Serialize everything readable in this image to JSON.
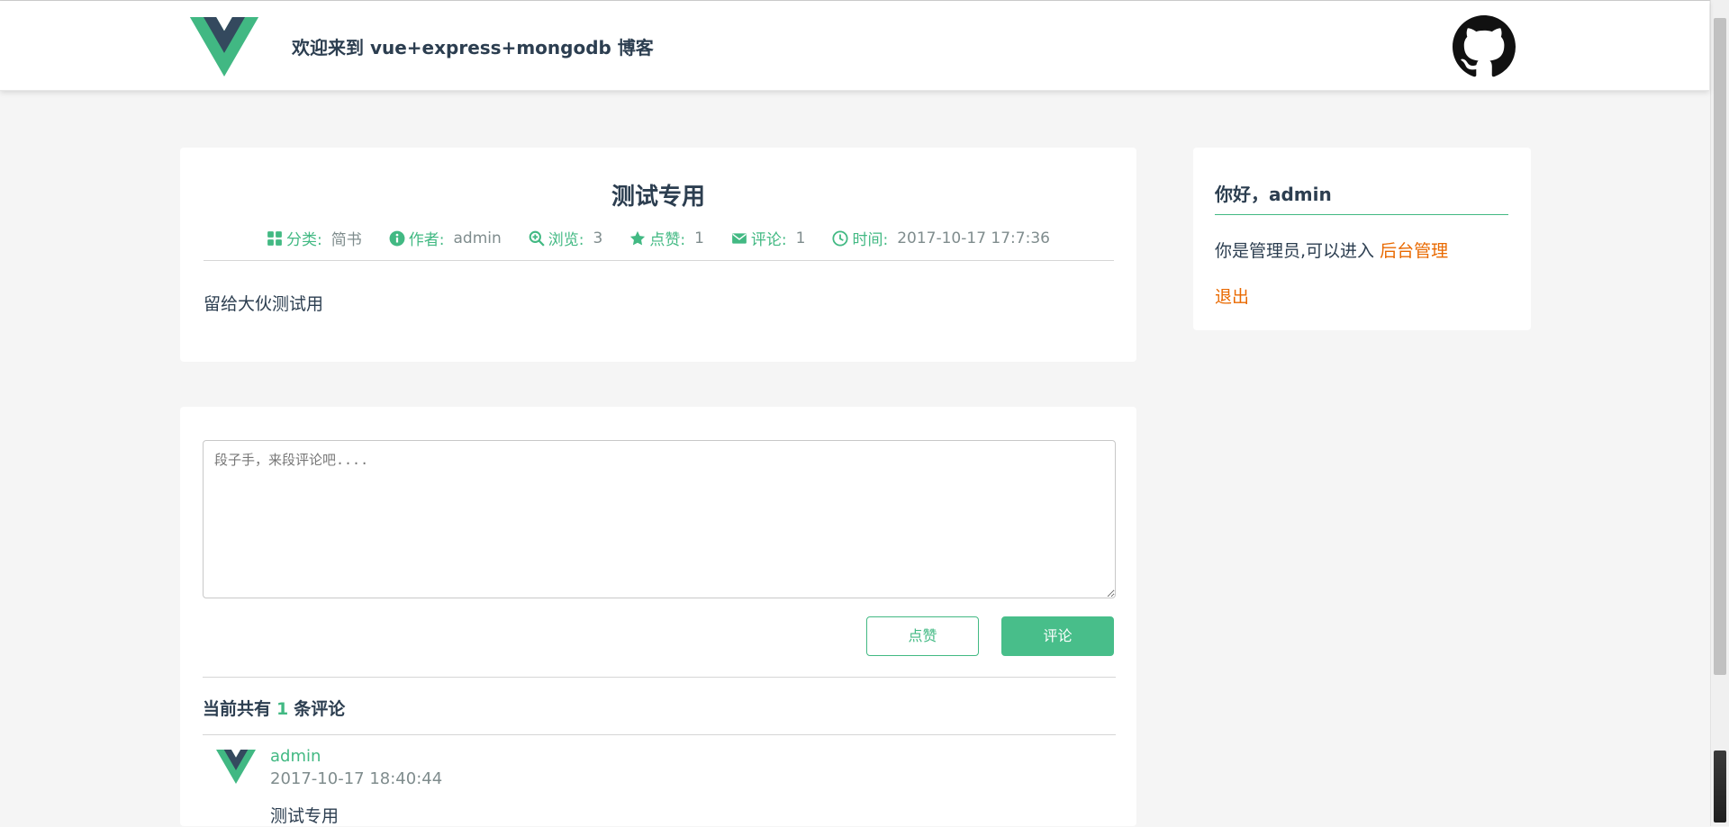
{
  "header": {
    "site_title": "欢迎来到 vue+express+mongodb 博客"
  },
  "article": {
    "title": "测试专用",
    "meta": {
      "category_label": "分类:",
      "category_value": "简书",
      "author_label": "作者:",
      "author_value": "admin",
      "views_label": "浏览:",
      "views_value": "3",
      "likes_label": "点赞:",
      "likes_value": "1",
      "comments_label": "评论:",
      "comments_value": "1",
      "time_label": "时间:",
      "time_value": "2017-10-17 17:7:36"
    },
    "body": "留给大伙测试用"
  },
  "sidebar": {
    "greeting": "你好，admin",
    "admin_note": "你是管理员,可以进入",
    "admin_link": "后台管理",
    "logout": "退出"
  },
  "comment_form": {
    "placeholder": "段子手，来段评论吧....",
    "like_button": "点赞",
    "comment_button": "评论"
  },
  "comments": {
    "count_prefix": "当前共有",
    "count": "1",
    "count_suffix": "条评论",
    "items": [
      {
        "user": "admin",
        "time": "2017-10-17 18:40:44",
        "text": "测试专用"
      }
    ]
  },
  "colors": {
    "accent_green": "#42b983",
    "accent_orange": "#e96900",
    "text_dark": "#2c3e50",
    "text_muted": "#7f8c8d"
  }
}
